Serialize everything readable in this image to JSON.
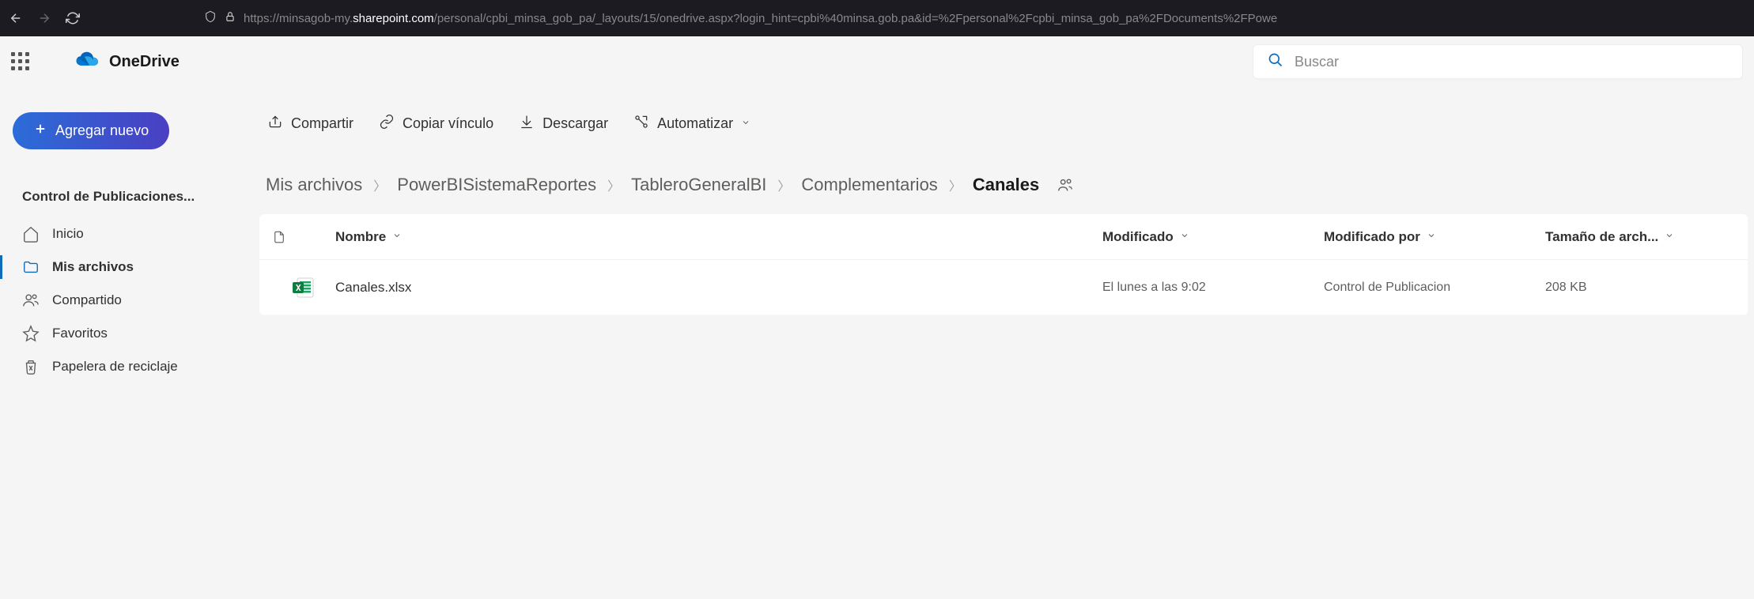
{
  "browser": {
    "url_prefix": "https://minsagob-my.",
    "url_domain": "sharepoint.com",
    "url_suffix": "/personal/cpbi_minsa_gob_pa/_layouts/15/onedrive.aspx?login_hint=cpbi%40minsa.gob.pa&id=%2Fpersonal%2Fcpbi_minsa_gob_pa%2FDocuments%2FPowe"
  },
  "app": {
    "name": "OneDrive",
    "search_placeholder": "Buscar",
    "add_new_label": "Agregar nuevo"
  },
  "sidebar": {
    "section_title": "Control de Publicaciones...",
    "items": [
      {
        "label": "Inicio"
      },
      {
        "label": "Mis archivos"
      },
      {
        "label": "Compartido"
      },
      {
        "label": "Favoritos"
      },
      {
        "label": "Papelera de reciclaje"
      }
    ]
  },
  "toolbar": {
    "share": "Compartir",
    "copy_link": "Copiar vínculo",
    "download": "Descargar",
    "automate": "Automatizar"
  },
  "breadcrumb": [
    "Mis archivos",
    "PowerBISistemaReportes",
    "TableroGeneralBI",
    "Complementarios",
    "Canales"
  ],
  "columns": {
    "name": "Nombre",
    "modified": "Modificado",
    "modified_by": "Modificado por",
    "size": "Tamaño de arch..."
  },
  "files": [
    {
      "name": "Canales.xlsx",
      "modified": "El lunes a las 9:02",
      "modified_by": "Control de Publicacion",
      "size": "208 KB"
    }
  ]
}
